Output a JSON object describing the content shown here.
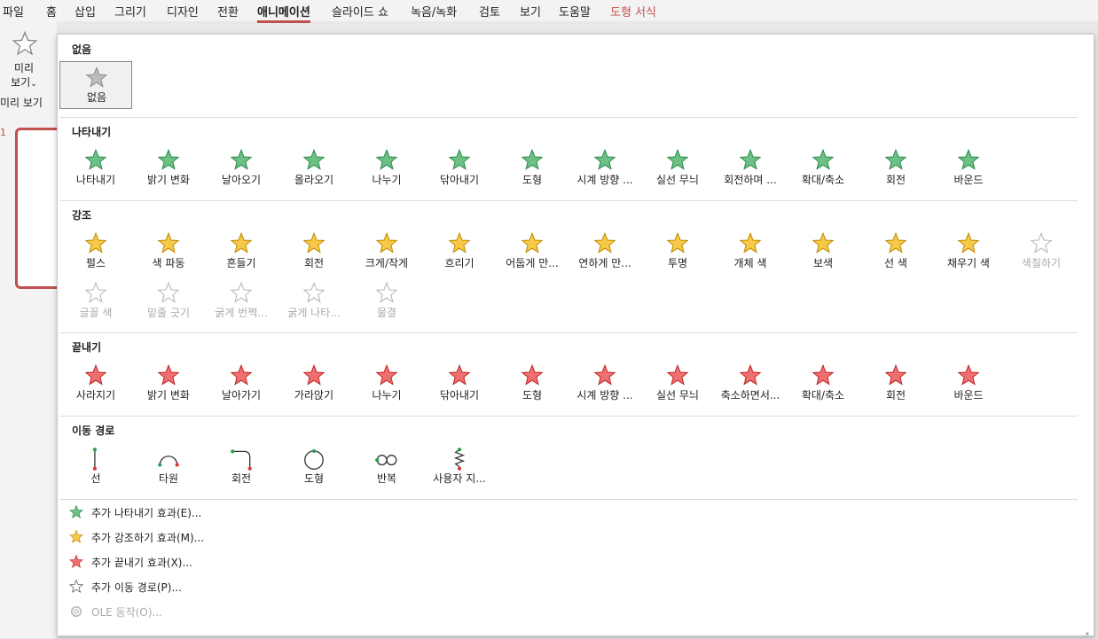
{
  "menubar": {
    "items": [
      "파일",
      "홈",
      "삽입",
      "그리기",
      "디자인",
      "전환",
      "애니메이션",
      "슬라이드 쇼",
      "녹음/녹화",
      "검토",
      "보기",
      "도움말",
      "도형 서식"
    ]
  },
  "preview": {
    "button_label": "미리\n보기",
    "group_label": "미리 보기"
  },
  "slide_number": "1",
  "colors": {
    "accent": "#c0504d",
    "entrance": "#3aa55a",
    "emphasis": "#f0b400",
    "exit": "#e03c3c"
  },
  "gallery": {
    "none": {
      "title": "없음",
      "items": [
        "없음"
      ]
    },
    "entrance": {
      "title": "나타내기",
      "items": [
        "나타내기",
        "밝기 변화",
        "날아오기",
        "올라오기",
        "나누기",
        "닦아내기",
        "도형",
        "시계 방향 ...",
        "실선 무늬",
        "회전하며 ...",
        "확대/축소",
        "회전",
        "바운드"
      ]
    },
    "emphasis": {
      "title": "강조",
      "items": [
        "펄스",
        "색 파동",
        "흔들기",
        "회전",
        "크게/작게",
        "흐리기",
        "어둡게 만...",
        "연하게 만...",
        "투명",
        "개체 색",
        "보색",
        "선 색",
        "채우기 색",
        "색칠하기",
        "글꼴 색",
        "밑줄 긋기",
        "굵게 번쩍...",
        "굵게 나타...",
        "물결"
      ]
    },
    "exit": {
      "title": "끝내기",
      "items": [
        "사라지기",
        "밝기 변화",
        "날아가기",
        "가라앉기",
        "나누기",
        "닦아내기",
        "도형",
        "시계 방향 ...",
        "실선 무늬",
        "축소하면서...",
        "확대/축소",
        "회전",
        "바운드"
      ]
    },
    "motion": {
      "title": "이동 경로",
      "items": [
        "선",
        "타원",
        "회전",
        "도형",
        "반복",
        "사용자 지..."
      ]
    }
  },
  "commands": [
    "추가 나타내기 효과(E)...",
    "추가 강조하기 효과(M)...",
    "추가 끝내기 효과(X)...",
    "추가 이동 경로(P)...",
    "OLE 동작(O)..."
  ],
  "icons": {
    "entrance": "green-star-icon",
    "emphasis": "gold-star-icon",
    "exit": "red-star-icon",
    "motion": "motion-path-icon",
    "ole": "gear-icon"
  }
}
